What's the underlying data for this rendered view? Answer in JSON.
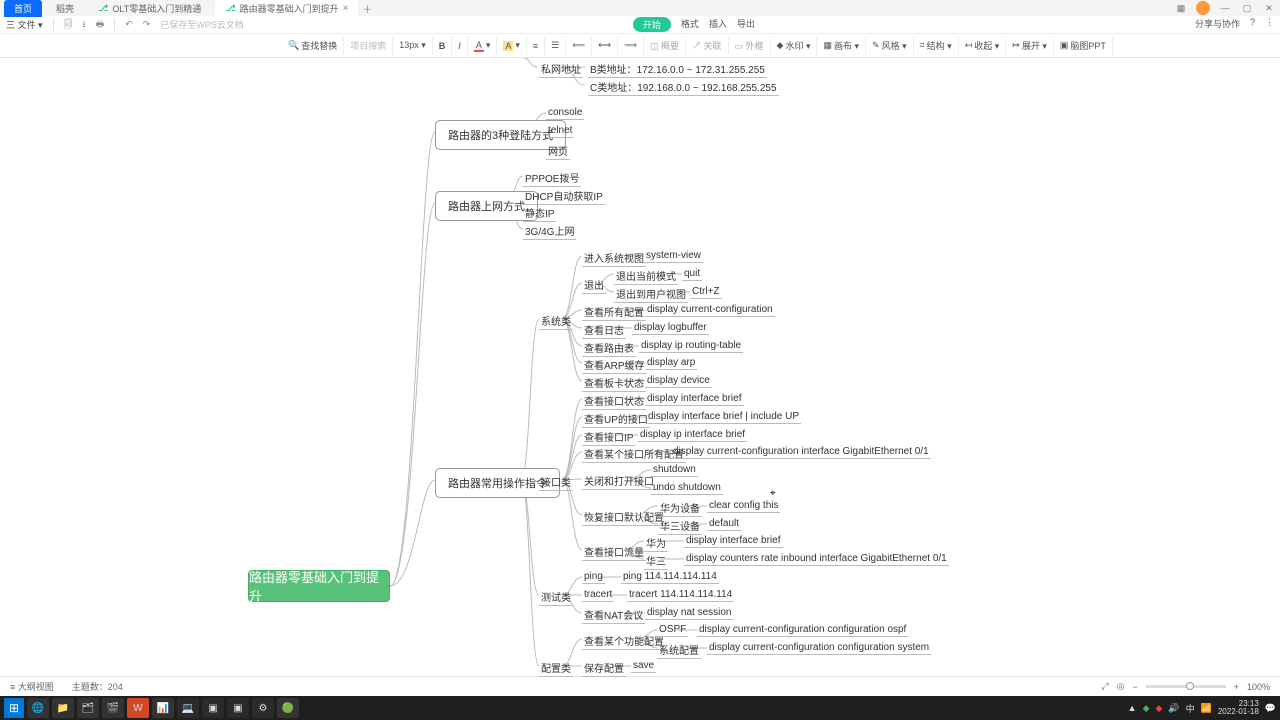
{
  "titlebar": {
    "tabs": [
      "首页",
      "稻壳",
      "OLT零基础入门到精通",
      "路由器零基础入门到提升"
    ],
    "share": "分享与协作"
  },
  "menubar": {
    "file": "三 文件 ▾",
    "hint": "已保存至WPS云文档",
    "open": "开始",
    "right": [
      "格式",
      "插入",
      "导出"
    ]
  },
  "toolbar": {
    "search": "查找替换",
    "sel": "项目搜索",
    "font": "13px ▾",
    "items": [
      "水印 ▾",
      "画布 ▾",
      "风格 ▾",
      "结构 ▾",
      "收起 ▾",
      "展开 ▾",
      "脑图PPT"
    ]
  },
  "root": "路由器零基础入门到提升",
  "boxes": {
    "b1": "路由器的3种登陆方式",
    "b2": "路由器上网方式",
    "b3": "路由器常用操作指令"
  },
  "n": {
    "priv": "私网地址",
    "bnet": "B类地址：172.16.0.0 ~ 172.31.255.255",
    "cnet": "C类地址：192.168.0.0 ~ 192.168.255.255",
    "console": "console",
    "telnet": "telnet",
    "web": "网页",
    "pppoe": "PPPOE拨号",
    "dhcp": "DHCP自动获取IP",
    "static": "静态IP",
    "g34": "3G/4G上网",
    "sys": "系统类",
    "if": "接口类",
    "test": "测试类",
    "cfg": "配置类",
    "enter": "进入系统视图",
    "enterCmd": "system-view",
    "exit": "退出",
    "exitCur": "退出当前模式",
    "quit": "quit",
    "exitUser": "退出到用户视图",
    "ctrlz": "Ctrl+Z",
    "allcfg": "查看所有配置",
    "allcfgCmd": "display current-configuration",
    "log": "查看日志",
    "logCmd": "display logbuffer",
    "rt": "查看路由表",
    "rtCmd": "display ip routing-table",
    "arp": "查看ARP缓存",
    "arpCmd": "display arp",
    "dev": "查看板卡状态",
    "devCmd": "display device",
    "ifstat": "查看接口状态",
    "ifstatCmd": "display interface brief",
    "ifup": "查看UP的接口",
    "ifupCmd": "display interface brief | include UP",
    "ifip": "查看接口IP",
    "ifipCmd": "display ip interface brief",
    "ifcfg": "查看某个接口所有配置",
    "ifcfgCmd": "display current-configuration interface GigabitEthernet 0/1",
    "shut": "关闭和打开接口",
    "shutdown": "shutdown",
    "undoshut": "undo shutdown",
    "reset": "恢复接口默认配置",
    "hw": "华为设备",
    "hwCmd": "clear config this",
    "h3c": "华三设备",
    "h3cCmd": "default",
    "traf": "查看接口流量",
    "trafHw": "华为",
    "trafHwCmd": "display interface brief",
    "trafH3c": "华三",
    "trafH3cCmd": "display counters rate inbound interface GigabitEthernet 0/1",
    "ping": "ping",
    "pingCmd": "ping 114.114.114.114",
    "tracert": "tracert",
    "tracertCmd": "tracert 114.114.114.114",
    "nat": "查看NAT会议",
    "natCmd": "display nat session",
    "func": "查看某个功能配置",
    "ospf": "OSPF",
    "ospfCmd": "display current-configuration configuration ospf",
    "syscfg": "系统配置",
    "syscfgCmd": "display current-configuration configuration system",
    "save": "保存配置",
    "saveCmd": "save"
  },
  "status": {
    "view": "大纲视图",
    "topics": "主题数：204",
    "zoom": "100%"
  },
  "clock": {
    "time": "23:13",
    "date": "2022-01-18"
  }
}
